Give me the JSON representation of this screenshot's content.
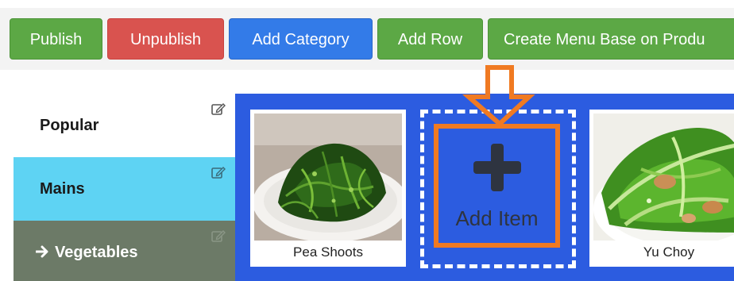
{
  "toolbar": {
    "publish_label": "Publish",
    "unpublish_label": "Unpublish",
    "add_category_label": "Add Category",
    "add_row_label": "Add Row",
    "create_menu_label": "Create Menu Base on Produ"
  },
  "sidebar": {
    "items": [
      {
        "label": "Popular",
        "icon": "edit-icon"
      },
      {
        "label": "Mains",
        "icon": "edit-icon"
      },
      {
        "label": "Vegetables",
        "prefix_icon": "arrow-right-icon",
        "icon": "edit-icon",
        "active": true
      }
    ]
  },
  "menu_items": [
    {
      "name": "Pea Shoots",
      "image": "stir-fried green vegetables on white plate"
    },
    {
      "name": "Yu Choy",
      "image": "stir-fried leafy greens on white plate"
    }
  ],
  "add_item": {
    "label": "Add Item",
    "icon": "plus-icon"
  },
  "colors": {
    "green": "#5ca845",
    "red": "#d9534f",
    "blue": "#337be8",
    "item_area": "#2c5ce0",
    "highlight": "#f07a22",
    "mains_bg": "#5ed3f3",
    "active_bg": "#6c7a67"
  }
}
